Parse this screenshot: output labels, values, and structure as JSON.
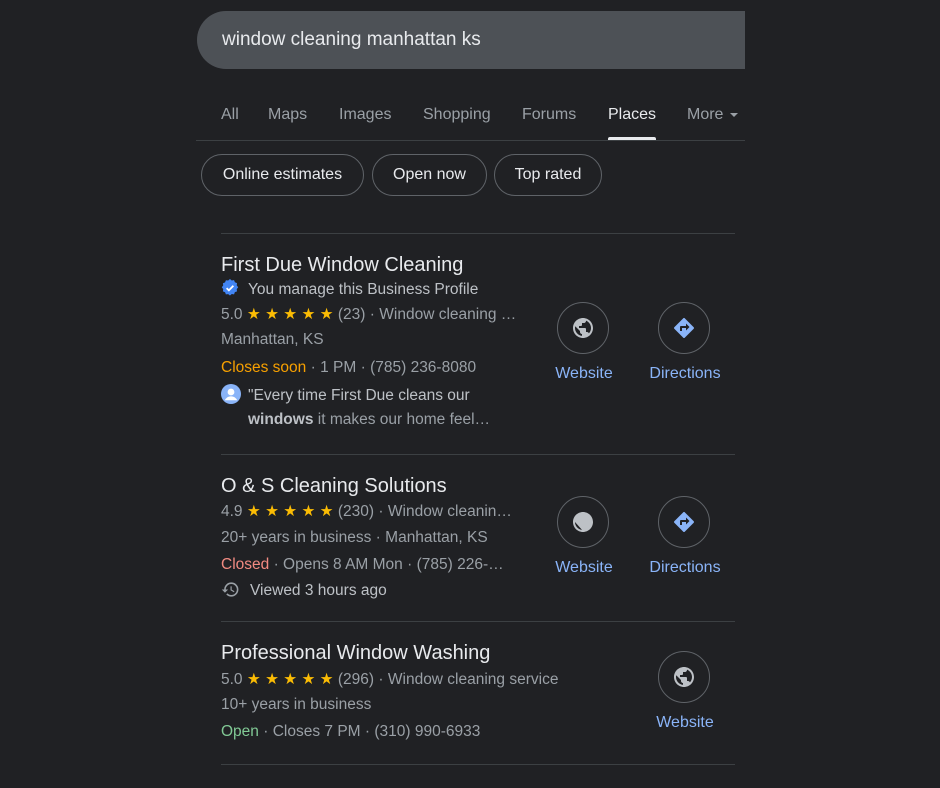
{
  "search": {
    "query": "window cleaning manhattan ks"
  },
  "tabs": [
    "All",
    "Maps",
    "Images",
    "Shopping",
    "Forums",
    "Places",
    "More"
  ],
  "active_tab": "Places",
  "chips": [
    "Online estimates",
    "Open now",
    "Top rated"
  ],
  "colors": {
    "background": "#202124",
    "link": "#8ab4f8",
    "star": "#fbbc04",
    "closes_soon": "#f7a000",
    "closed": "#f28b82",
    "open": "#81c995",
    "verified": "#4285f4"
  },
  "results": [
    {
      "name": "First Due Window Cleaning",
      "verified_text": "You manage this Business Profile",
      "rating": "5.0",
      "stars": 5,
      "reviews": "(23)",
      "category": "Window cleaning …",
      "address": "Manhattan, KS",
      "status": "Closes soon",
      "hours": "1 PM",
      "phone": "(785) 236-8080",
      "review_prefix": "\"Every time First Due cleans our",
      "review_bold": "windows",
      "review_suffix": "it makes our home feel…",
      "website_label": "Website",
      "directions_label": "Directions"
    },
    {
      "name": "O & S Cleaning Solutions",
      "rating": "4.9",
      "stars": 5,
      "reviews": "(230)",
      "category": "Window cleanin…",
      "years": "20+ years in business",
      "address": "Manhattan, KS",
      "status": "Closed",
      "hours": "Opens 8 AM Mon",
      "phone": "(785) 226-…",
      "viewed": "Viewed 3 hours ago",
      "website_label": "Website",
      "directions_label": "Directions"
    },
    {
      "name": "Professional Window Washing",
      "rating": "5.0",
      "stars": 5,
      "reviews": "(296)",
      "category": "Window cleaning service",
      "years": "10+ years in business",
      "status": "Open",
      "hours": "Closes 7 PM",
      "phone": "(310) 990-6933",
      "website_label": "Website"
    }
  ],
  "icons": [
    "globe-icon",
    "directions-icon",
    "verified-icon",
    "avatar-icon",
    "history-icon",
    "star-icon",
    "caret-down-icon"
  ],
  "star_glyph": "★ ★ ★ ★ ★",
  "dot": "·"
}
